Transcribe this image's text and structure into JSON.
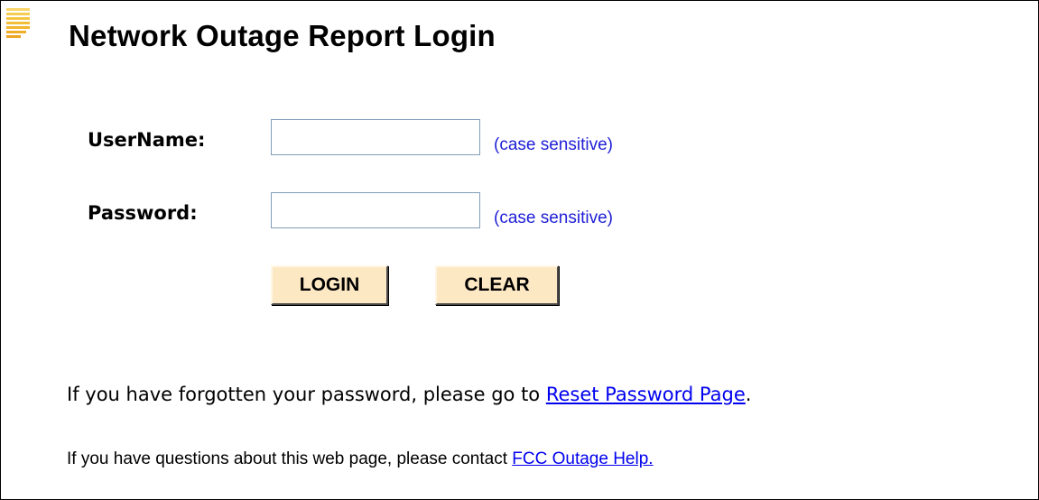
{
  "page": {
    "title": "Network Outage Report Login"
  },
  "form": {
    "username_label": "UserName:",
    "username_value": "",
    "username_hint": "(case sensitive)",
    "password_label": "Password:",
    "password_value": "",
    "password_hint": "(case sensitive)",
    "login_button": "LOGIN",
    "clear_button": "CLEAR"
  },
  "footer": {
    "forgot_prefix": "If you have forgotten your password, please go to ",
    "forgot_link": "Reset Password Page",
    "forgot_suffix": ".",
    "questions_prefix": "If you have questions about this web page, please contact ",
    "questions_link": "FCC Outage Help."
  },
  "colors": {
    "button_bg": "#fde8c4",
    "hint": "#1f1fd6",
    "link": "#0000ee",
    "logo": "#f5c542"
  },
  "icons": {
    "logo": "striped-logo-icon"
  }
}
